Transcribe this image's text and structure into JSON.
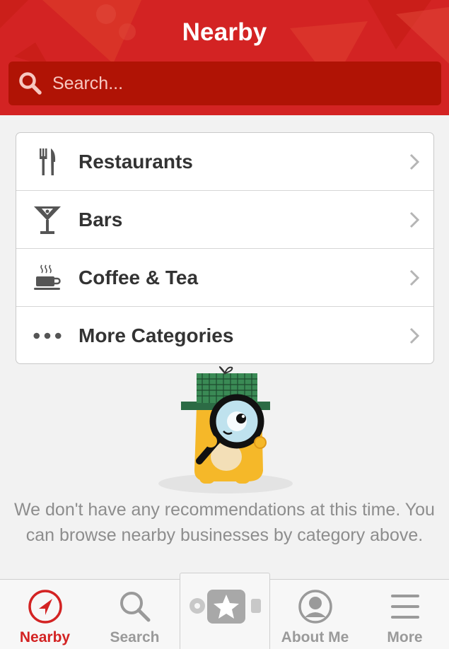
{
  "header": {
    "title": "Nearby",
    "search_placeholder": "Search...",
    "color": "#d32323"
  },
  "categories": [
    {
      "label": "Restaurants",
      "icon": "fork-knife-icon"
    },
    {
      "label": "Bars",
      "icon": "cocktail-glass-icon"
    },
    {
      "label": "Coffee & Tea",
      "icon": "coffee-cup-icon"
    },
    {
      "label": "More Categories",
      "icon": "more-dots-icon"
    }
  ],
  "empty_state": {
    "illustration": "detective-mascot-with-magnifying-glass",
    "message": "We don't have any recommendations at this time. You can browse nearby businesses by category above."
  },
  "tabbar": {
    "tabs": [
      {
        "label": "Nearby",
        "icon": "compass-arrow-icon",
        "active": true
      },
      {
        "label": "Search",
        "icon": "magnifier-icon",
        "active": false
      },
      {
        "label": "",
        "icon": "check-in-star-icon",
        "active": false
      },
      {
        "label": "About Me",
        "icon": "profile-icon",
        "active": false
      },
      {
        "label": "More",
        "icon": "hamburger-icon",
        "active": false
      }
    ],
    "active_color": "#d32323",
    "inactive_color": "#9a9a9a"
  }
}
